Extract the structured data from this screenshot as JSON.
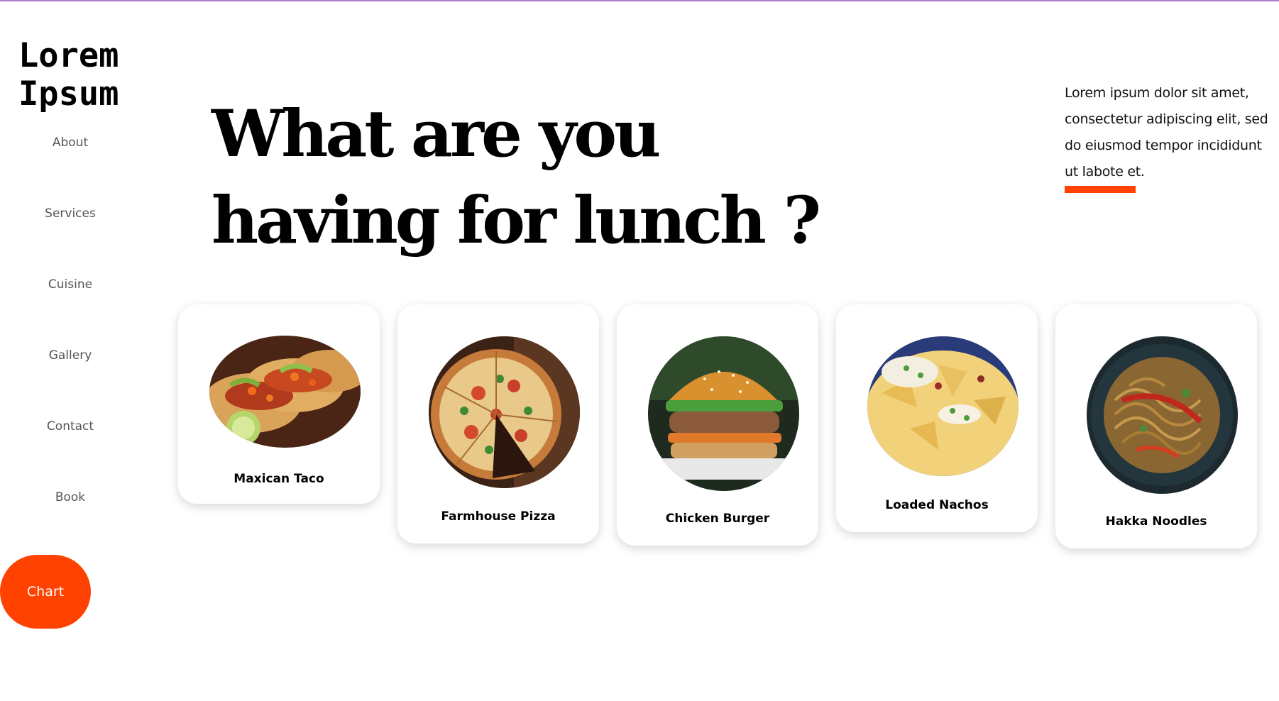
{
  "brand": {
    "line1": "Lorem",
    "line2": "Ipsum"
  },
  "nav": [
    "About",
    "Services",
    "Cuisine",
    "Gallery",
    "Contact",
    "Book"
  ],
  "chart_button": "Chart",
  "hero": {
    "line1": "What are you",
    "line2": "having for lunch ?"
  },
  "intro": {
    "text": "Lorem ipsum dolor sit amet, consectetur adipiscing elit, sed do eiusmod tempor incididunt ut labote et."
  },
  "dishes": [
    {
      "name": "Maxican Taco",
      "icon": "taco-photo"
    },
    {
      "name": "Farmhouse Pizza",
      "icon": "pizza-photo"
    },
    {
      "name": "Chicken Burger",
      "icon": "burger-photo"
    },
    {
      "name": "Loaded Nachos",
      "icon": "nachos-photo"
    },
    {
      "name": "Hakka Noodles",
      "icon": "noodles-photo"
    }
  ],
  "colors": {
    "accent": "#ff4200",
    "nav_text": "#555555",
    "heading": "#000000"
  }
}
